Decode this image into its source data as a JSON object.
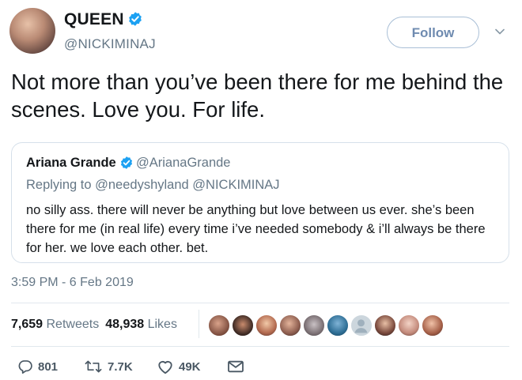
{
  "author": {
    "display_name": "QUEEN",
    "handle": "@NICKIMINAJ",
    "verified": true,
    "avatar_icon": "avatar-photo"
  },
  "follow_button": {
    "label": "Follow"
  },
  "tweet": {
    "text": "Not more than you’ve been there for me behind the scenes. Love you. For life."
  },
  "quoted_tweet": {
    "display_name": "Ariana Grande",
    "handle": "@ArianaGrande",
    "verified": true,
    "replying_to": "Replying to @needyshyland @NICKIMINAJ",
    "text": "no silly ass. there will never be anything but love between us ever. she’s been there for me (in real life) every time i’ve needed somebody & i’ll always be there for her. we love each other. bet."
  },
  "timestamp": "3:59 PM - 6 Feb 2019",
  "stats": {
    "retweets_count": "7,659",
    "retweets_label": "Retweets",
    "likes_count": "48,938",
    "likes_label": "Likes",
    "liker_avatars": 10
  },
  "actions": {
    "replies": "801",
    "retweets": "7.7K",
    "likes": "49K"
  },
  "colors": {
    "verified_blue": "#1da1f2",
    "secondary_text": "#657786",
    "border": "#e1e8ed"
  }
}
